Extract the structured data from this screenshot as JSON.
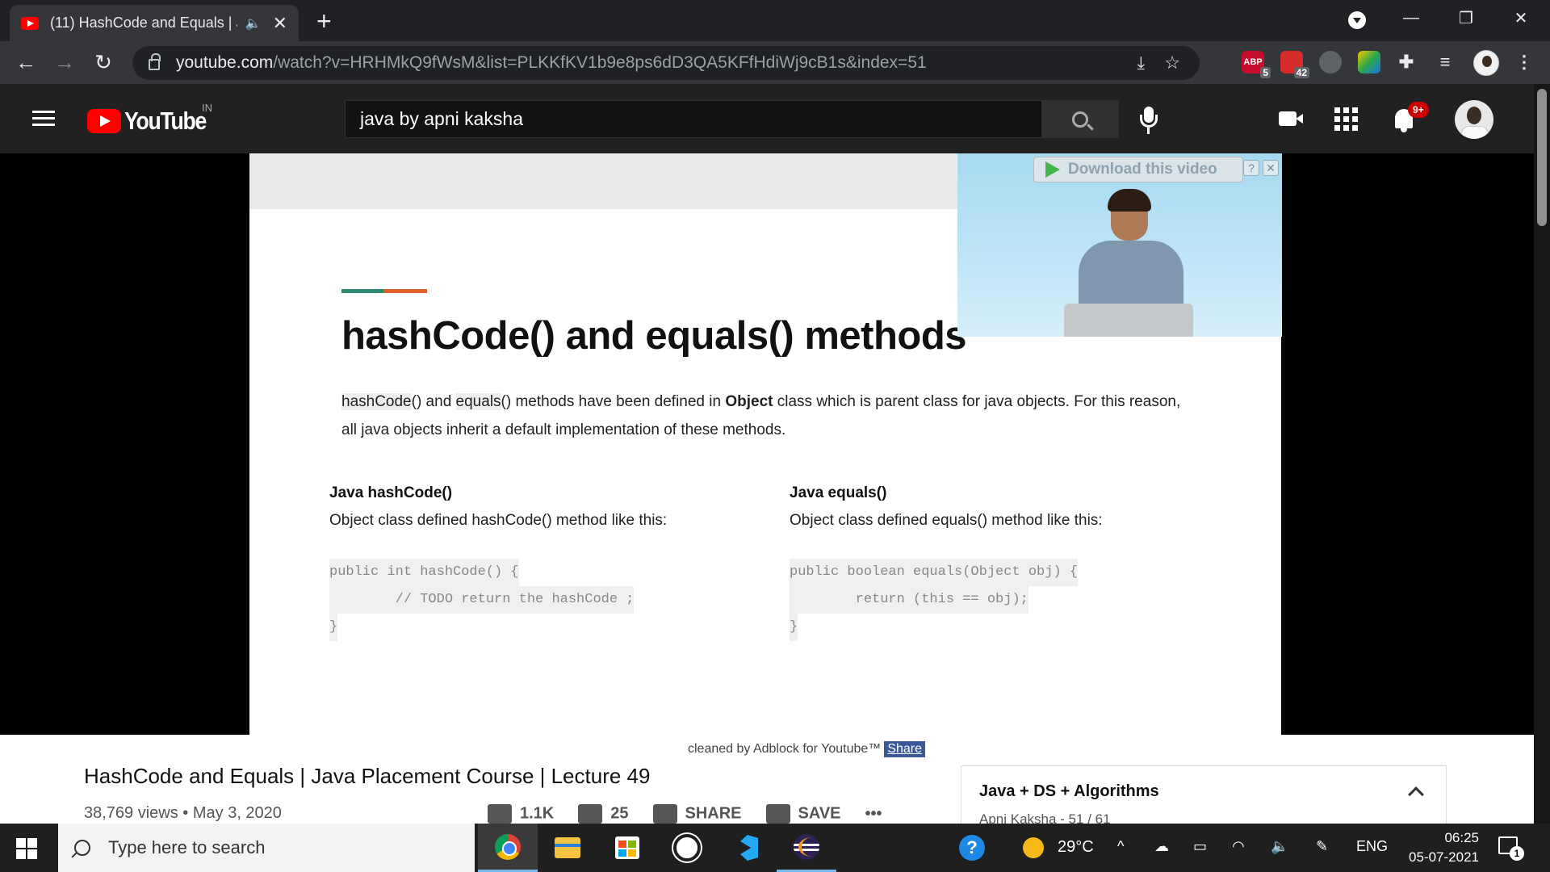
{
  "browser": {
    "tab_title": "(11) HashCode and Equals | J",
    "speaker_glyph": "🔈",
    "close_glyph": "✕",
    "new_tab_glyph": "+",
    "url_host": "youtube.com",
    "url_path": "/watch?v=HRHMkQ9fWsM&list=PLKKfKV1b9e8ps6dD3QA5KFfHdiWj9cB1s&index=51",
    "extensions": [
      {
        "name": "adblock",
        "label": "ABP",
        "badge": "5",
        "color": "#c70d2c"
      },
      {
        "name": "red-ext",
        "label": "",
        "badge": "42",
        "color": "#d62b2b"
      },
      {
        "name": "cloud-ext",
        "label": "",
        "badge": "",
        "color": "#5f6368"
      },
      {
        "name": "color-ext",
        "label": "",
        "badge": "",
        "color": "#2aa84a"
      }
    ]
  },
  "youtube": {
    "logo_text": "YouTube",
    "country": "IN",
    "search_query": "java by apni kaksha",
    "notification_count": "9+"
  },
  "slide": {
    "title": "hashCode() and equals() methods",
    "para_hl1": "hashCode",
    "para_t1": "() and ",
    "para_hl2": "equals",
    "para_t2": "() methods have been defined in ",
    "para_bold": "Object",
    "para_t3": " class which is parent class for java objects. For this reason, all java objects inherit a default implementation of these methods.",
    "left_heading": "Java hashCode()",
    "left_desc": "Object class defined hashCode() method like this:",
    "left_code": [
      "public int hashCode() {",
      "        // TODO return the hashCode ;",
      "}"
    ],
    "right_heading": "Java equals()",
    "right_desc": "Object class defined equals() method like this:",
    "right_code": [
      "public boolean equals(Object obj) {",
      "        return (this == obj);",
      "}"
    ],
    "download_label": "Download this video",
    "download_help": "?",
    "download_close": "✕"
  },
  "video": {
    "adblock_note": "cleaned by Adblock for Youtube™",
    "share_label": "Share",
    "title": "HashCode and Equals | Java Placement Course | Lecture 49",
    "meta": "38,769 views • May 3, 2020",
    "likes": "1.1K",
    "dislikes": "25",
    "share": "SHARE",
    "save": "SAVE",
    "more": "•••"
  },
  "playlist": {
    "title": "Java + DS + Algorithms",
    "subtitle": "Apni Kaksha - 51 / 61"
  },
  "taskbar": {
    "search_placeholder": "Type here to search",
    "temperature": "29°C",
    "language": "ENG",
    "time": "06:25",
    "date": "05-07-2021",
    "notification_count": "1",
    "help_glyph": "?"
  }
}
